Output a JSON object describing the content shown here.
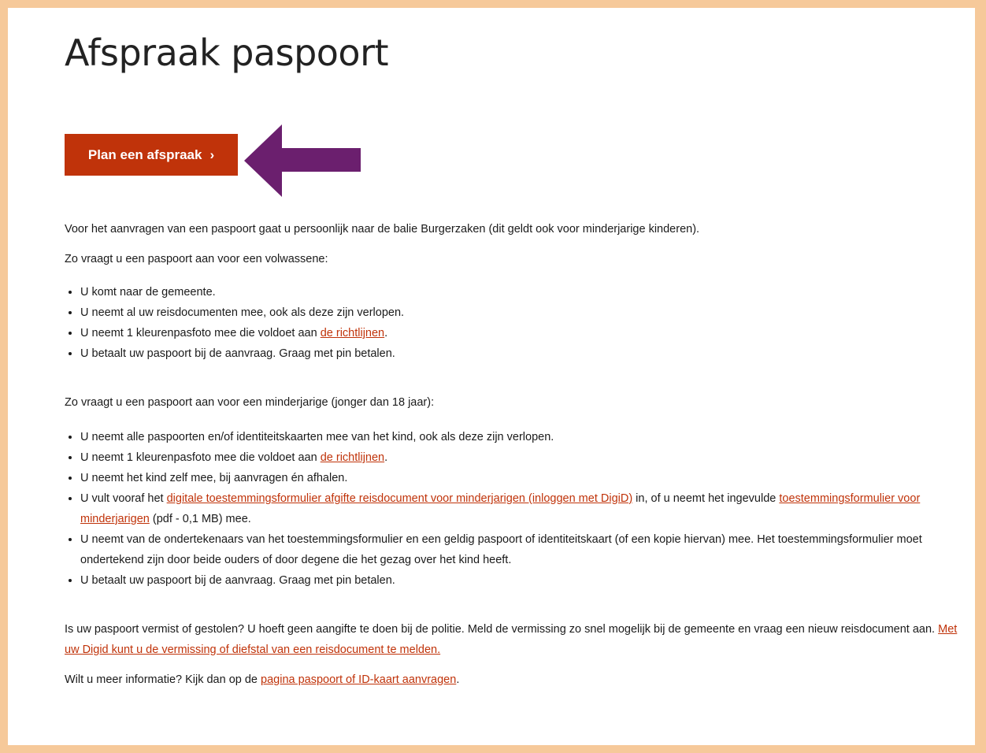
{
  "page": {
    "title": "Afspraak paspoort",
    "cta_label": "Plan een afspraak",
    "cta_chevron": "›"
  },
  "colors": {
    "accent": "#c0330a",
    "arrow": "#6b1f6e",
    "border": "#f6c99a"
  },
  "icons": {
    "arrow": "left-arrow-icon",
    "chevron": "chevron-right-icon"
  },
  "intro": "Voor het aanvragen van een paspoort gaat u persoonlijk naar de balie Burgerzaken (dit geldt ook voor minderjarige kinderen).",
  "adult": {
    "heading": "Zo vraagt u een paspoort aan voor een volwassene:",
    "items": {
      "i1": "U komt naar de gemeente.",
      "i2": "U neemt al uw reisdocumenten mee, ook als deze zijn verlopen.",
      "i3_pre": "U neemt 1 kleurenpasfoto mee die voldoet aan ",
      "i3_link": "de richtlijnen",
      "i3_post": ".",
      "i4": "U betaalt uw paspoort bij de aanvraag. Graag met pin betalen."
    }
  },
  "minor": {
    "heading": "Zo vraagt u een paspoort aan voor een minderjarige (jonger dan 18 jaar):",
    "items": {
      "i1": "U neemt alle paspoorten en/of identiteitskaarten mee van het kind, ook als deze zijn verlopen.",
      "i2_pre": "U neemt 1 kleurenpasfoto mee die voldoet aan ",
      "i2_link": "de richtlijnen",
      "i2_post": ".",
      "i3": "U neemt het kind zelf mee, bij aanvragen én afhalen.",
      "i4_pre": "U vult vooraf het ",
      "i4_link1": "digitale toestemmingsformulier afgifte reisdocument voor minderjarigen (inloggen met DigiD)",
      "i4_mid": " in, of u neemt het ingevulde ",
      "i4_link2": "toestemmingsformulier voor minderjarigen",
      "i4_post": " (pdf - 0,1 MB)  mee.",
      "i5": "U neemt van de ondertekenaars van het toestemmingsformulier en een geldig paspoort of identiteitskaart (of een kopie hiervan) mee. Het toestemmingsformulier moet ondertekend zijn door beide ouders of door degene die het gezag over het kind heeft.",
      "i6": "U betaalt uw paspoort bij de aanvraag. Graag met pin betalen."
    }
  },
  "lost": {
    "text": "Is uw paspoort vermist of gestolen? U hoeft geen aangifte te doen bij de politie. Meld de vermissing zo snel mogelijk bij de gemeente en vraag een nieuw reisdocument aan. ",
    "link": "Met uw Digid kunt u de vermissing of diefstal van een reisdocument te melden."
  },
  "more": {
    "pre": "Wilt u meer informatie? Kijk dan op de ",
    "link": "pagina paspoort of ID-kaart aanvragen",
    "post": "."
  }
}
